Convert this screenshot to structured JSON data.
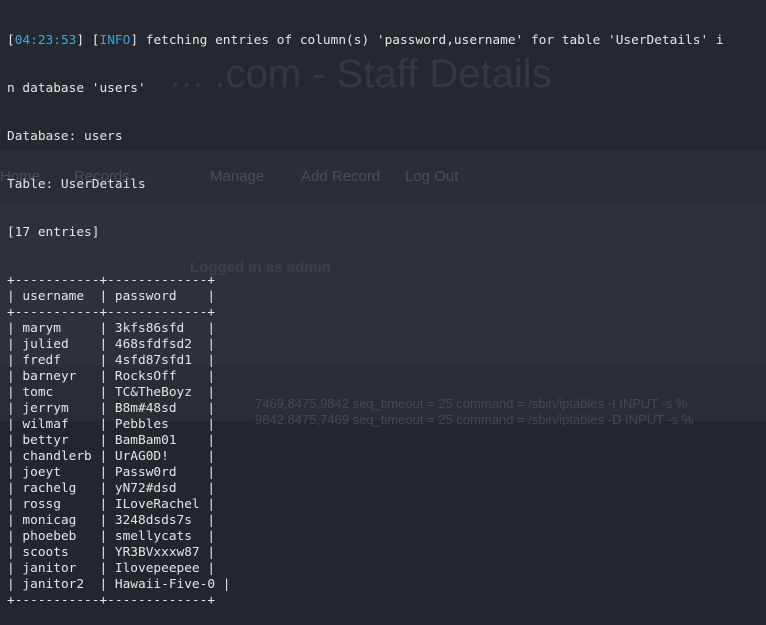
{
  "background_page": {
    "title": "... .com - Staff Details",
    "nav": [
      "Home",
      "Records",
      "Manage",
      "Add Record",
      "Log Out"
    ],
    "user_line": "Logged in as admin",
    "log_line_1": "7469,8475,9842 seq_timeout = 25 command = /sbin/iptables -I INPUT -s %",
    "log_line_2": "9842,8475,7469 seq_timeout = 25 command = /sbin/iptables -D INPUT -s %"
  },
  "terminal": {
    "timestamp": "04:23:53",
    "level": "INFO",
    "message": "fetching entries of column(s) 'password,username' for table 'UserDetails' in database 'users'",
    "message_part1": " fetching entries of column(s) 'password,username' for table 'UserDetails' i",
    "message_part2": "n database 'users'",
    "database_line": "Database: users",
    "table_line": "Table: UserDetails",
    "entries_line": "[17 entries]",
    "border": "+-----------+-------------+",
    "headers": [
      "username",
      "password"
    ],
    "rows": [
      [
        "marym",
        "3kfs86sfd"
      ],
      [
        "julied",
        "468sfdfsd2"
      ],
      [
        "fredf",
        "4sfd87sfd1"
      ],
      [
        "barneyr",
        "RocksOff"
      ],
      [
        "tomc",
        "TC&TheBoyz"
      ],
      [
        "jerrym",
        "B8m#48sd"
      ],
      [
        "wilmaf",
        "Pebbles"
      ],
      [
        "bettyr",
        "BamBam01"
      ],
      [
        "chandlerb",
        "UrAG0D!"
      ],
      [
        "joeyt",
        "Passw0rd"
      ],
      [
        "rachelg",
        "yN72#dsd"
      ],
      [
        "rossg",
        "ILoveRachel"
      ],
      [
        "monicag",
        "3248dsds7s"
      ],
      [
        "phoebeb",
        "smellycats"
      ],
      [
        "scoots",
        "YR3BVxxxw87"
      ],
      [
        "janitor",
        "Ilovepeepee"
      ],
      [
        "janitor2",
        "Hawaii-Five-0"
      ]
    ]
  },
  "colors": {
    "terminal_bg": "#23262c",
    "text": "#e6e6e6",
    "timestamp": "#4aa3df"
  }
}
